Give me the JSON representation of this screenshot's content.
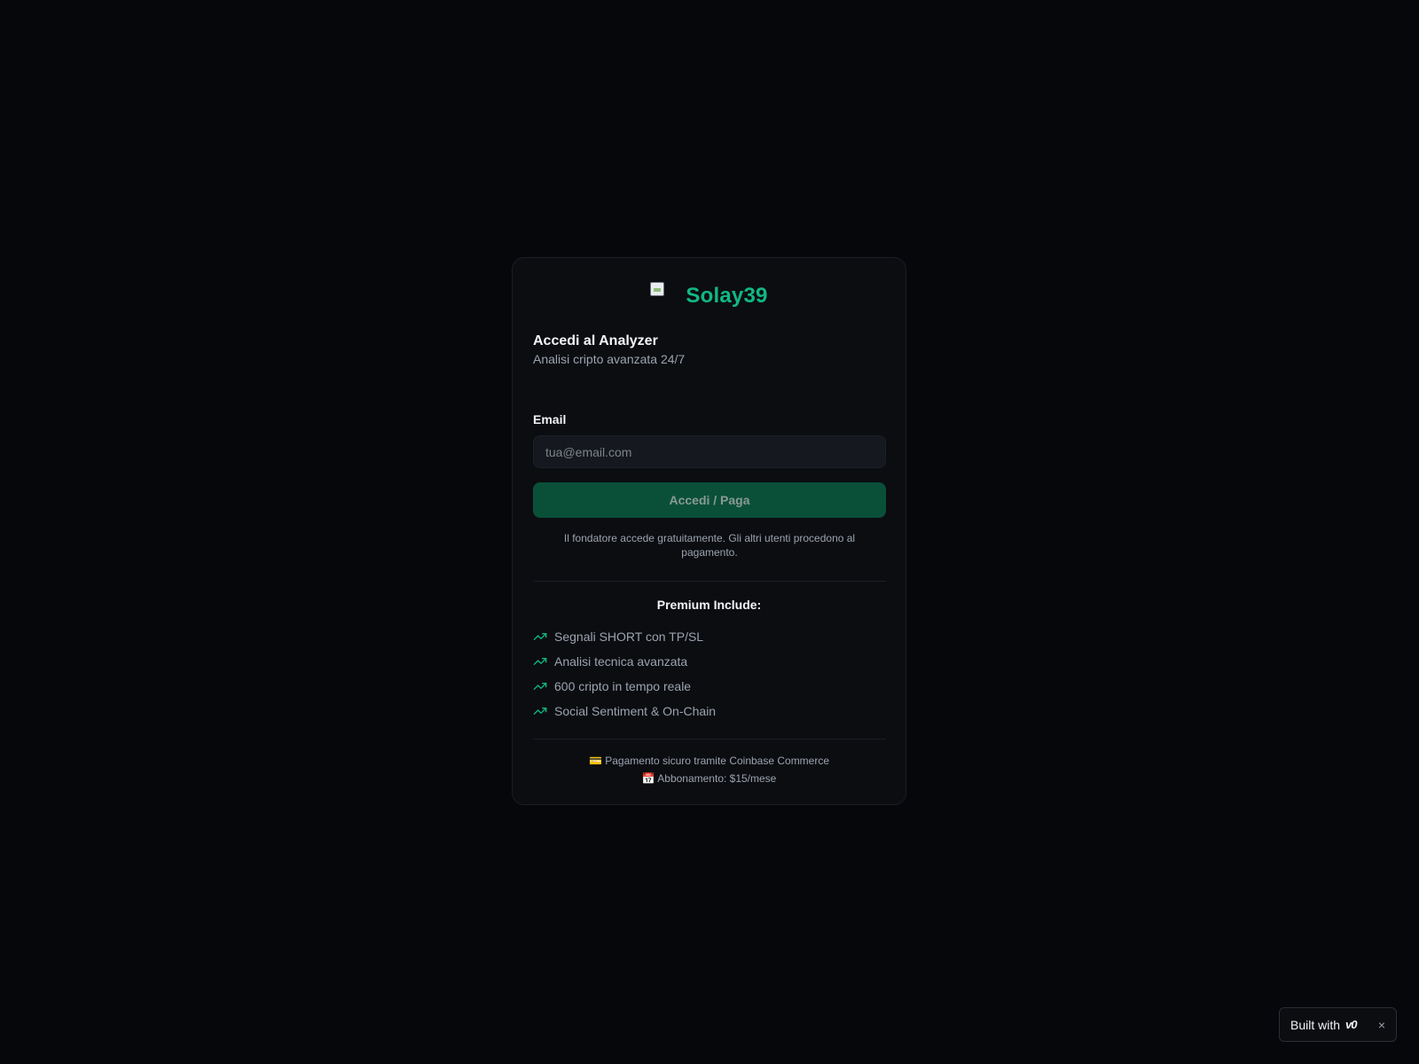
{
  "brand": {
    "name": "Solay39",
    "accent_color": "#10b981"
  },
  "header": {
    "title": "Accedi al Analyzer",
    "subtitle": "Analisi cripto avanzata 24/7"
  },
  "form": {
    "email_label": "Email",
    "email_placeholder": "tua@email.com",
    "email_value": "",
    "submit_label": "Accedi / Paga",
    "note": "Il fondatore accede gratuitamente. Gli altri utenti procedono al pagamento."
  },
  "premium": {
    "title": "Premium Include:",
    "icon": "trending-up-icon",
    "features": [
      "Segnali SHORT con TP/SL",
      "Analisi tecnica avanzata",
      "600 cripto in tempo reale",
      "Social Sentiment & On-Chain"
    ]
  },
  "footer": {
    "payment_icon": "💳",
    "payment_text": "Pagamento sicuro tramite Coinbase Commerce",
    "subscription_icon": "📅",
    "subscription_text": "Abbonamento: $15/mese"
  },
  "badge": {
    "label": "Built with",
    "logo": "v0",
    "close": "×"
  }
}
